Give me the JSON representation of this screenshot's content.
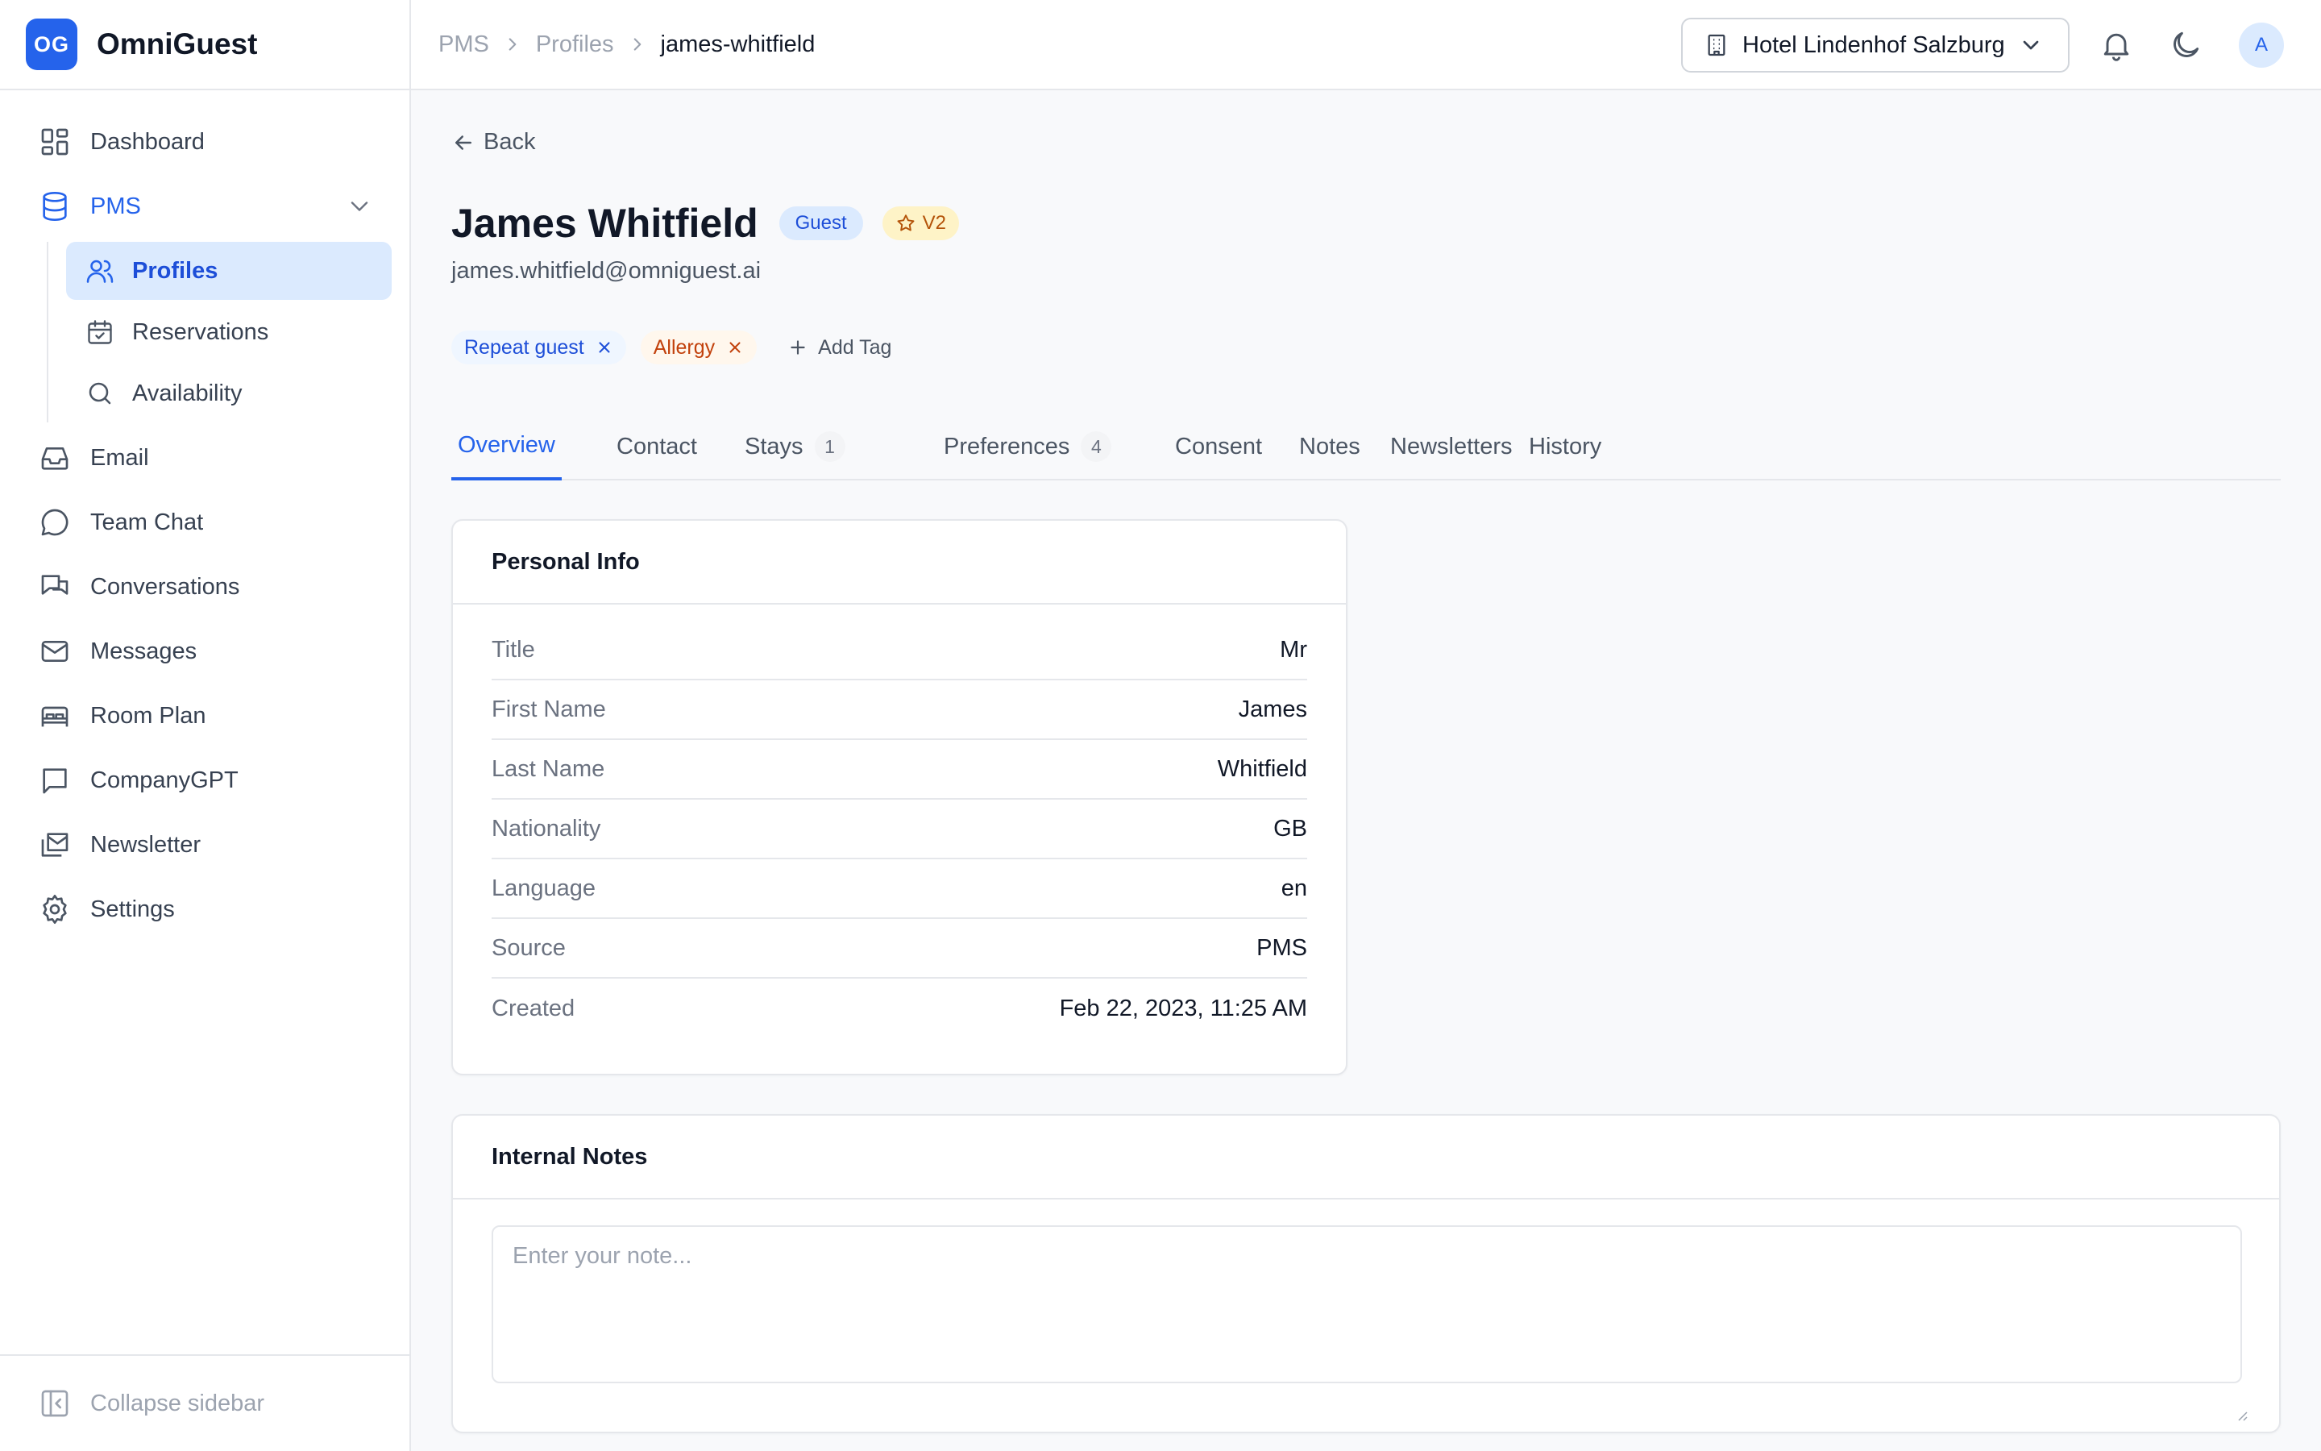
{
  "brand": {
    "logo": "OG",
    "name": "OmniGuest",
    "accent": "#2563eb"
  },
  "sidebar": {
    "items": [
      {
        "label": "Dashboard",
        "icon": "dashboard-icon"
      },
      {
        "label": "PMS",
        "icon": "database-icon",
        "expanded": true
      },
      {
        "label": "Email",
        "icon": "inbox-icon"
      },
      {
        "label": "Team Chat",
        "icon": "chat-bubble-icon"
      },
      {
        "label": "Conversations",
        "icon": "conversations-icon"
      },
      {
        "label": "Messages",
        "icon": "mail-icon"
      },
      {
        "label": "Room Plan",
        "icon": "bed-icon"
      },
      {
        "label": "CompanyGPT",
        "icon": "message-square-icon"
      },
      {
        "label": "Newsletter",
        "icon": "newsletter-icon"
      },
      {
        "label": "Settings",
        "icon": "gear-icon"
      }
    ],
    "pms_children": [
      {
        "label": "Profiles",
        "icon": "users-icon",
        "active": true
      },
      {
        "label": "Reservations",
        "icon": "calendar-check-icon"
      },
      {
        "label": "Availability",
        "icon": "search-icon"
      }
    ],
    "collapse_label": "Collapse sidebar"
  },
  "topbar": {
    "breadcrumb": [
      "PMS",
      "Profiles",
      "james-whitfield"
    ],
    "hotel": "Hotel Lindenhof Salzburg",
    "avatar_initial": "A"
  },
  "profile": {
    "back_label": "Back",
    "name": "James Whitfield",
    "role_badge": "Guest",
    "version_badge": "V2",
    "email": "james.whitfield@omniguest.ai",
    "tags": [
      {
        "label": "Repeat guest",
        "color": "#1d4ed8"
      },
      {
        "label": "Allergy",
        "color": "#c2410c"
      }
    ],
    "add_tag_label": "Add Tag"
  },
  "tabs": [
    {
      "label": "Overview",
      "active": true
    },
    {
      "label": "Contact"
    },
    {
      "label": "Stays",
      "count": "1"
    },
    {
      "label": "Preferences",
      "count": "4"
    },
    {
      "label": "Consent"
    },
    {
      "label": "Notes"
    },
    {
      "label": "Newsletters"
    },
    {
      "label": "History"
    }
  ],
  "personal_info": {
    "title": "Personal Info",
    "rows": [
      {
        "label": "Title",
        "value": "Mr"
      },
      {
        "label": "First Name",
        "value": "James"
      },
      {
        "label": "Last Name",
        "value": "Whitfield"
      },
      {
        "label": "Nationality",
        "value": "GB"
      },
      {
        "label": "Language",
        "value": "en"
      },
      {
        "label": "Source",
        "value": "PMS"
      },
      {
        "label": "Created",
        "value": "Feb 22, 2023, 11:25 AM"
      }
    ]
  },
  "internal_notes": {
    "title": "Internal Notes",
    "placeholder": "Enter your note...",
    "value": ""
  }
}
